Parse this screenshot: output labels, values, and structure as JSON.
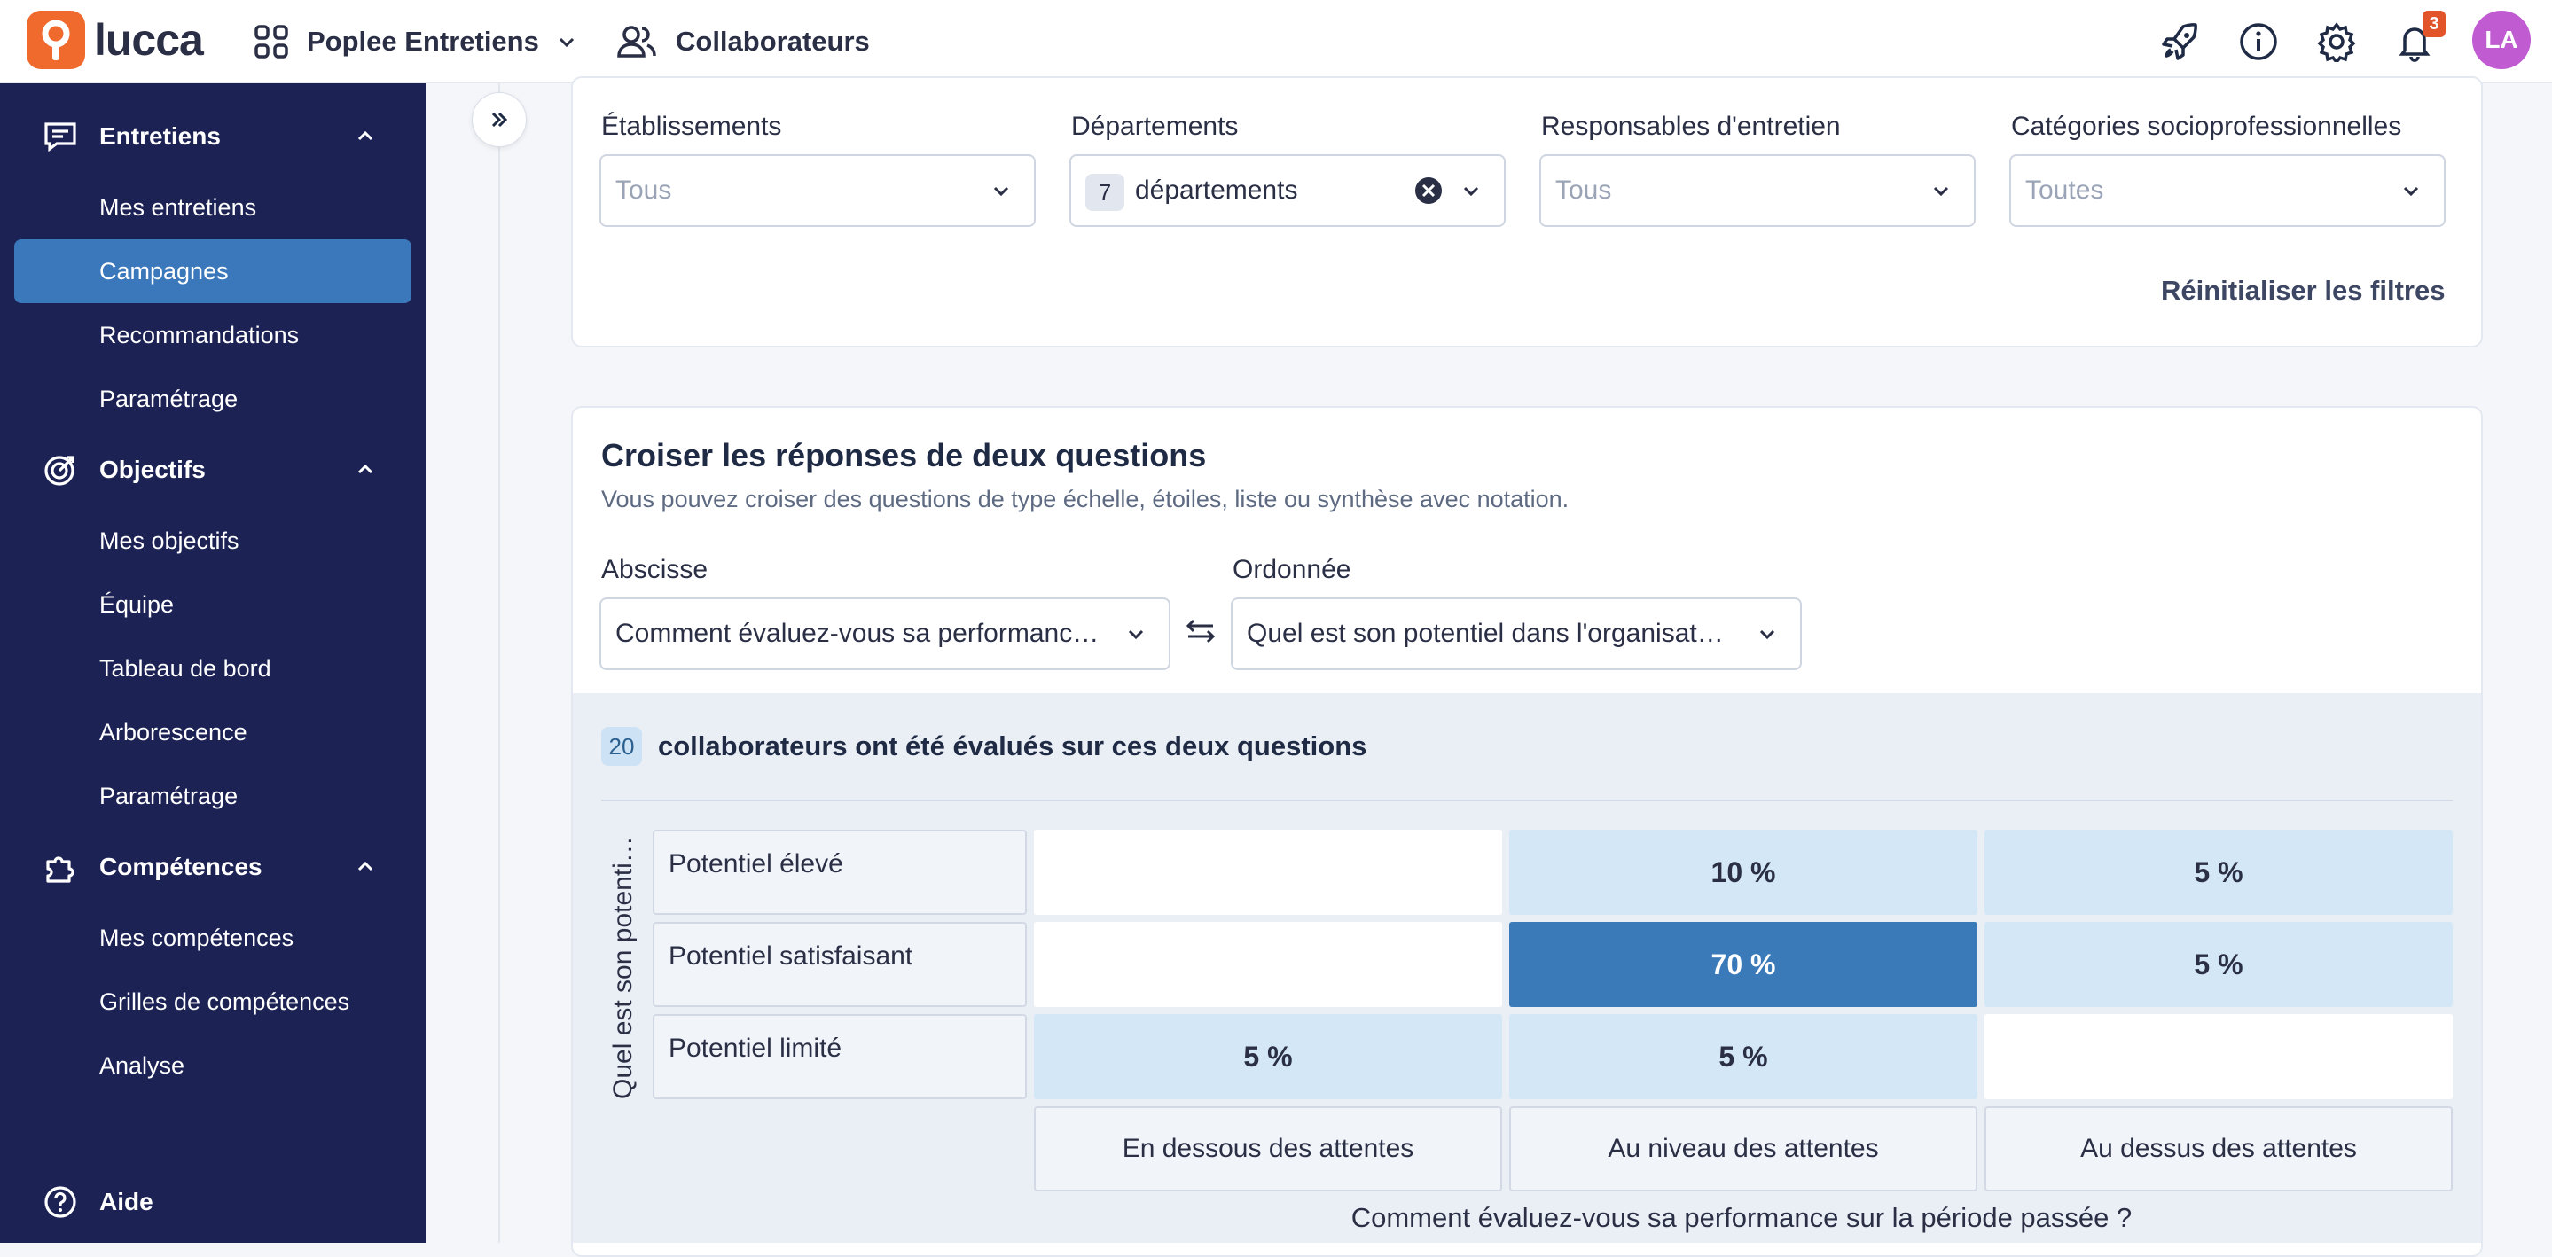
{
  "app": {
    "brand": "lucca",
    "module": "Poplee Entretiens",
    "collaborateurs": "Collaborateurs",
    "notifications": "3",
    "avatar": "LA"
  },
  "sidebar": {
    "entretiens": {
      "label": "Entretiens",
      "items": [
        "Mes entretiens",
        "Campagnes",
        "Recommandations",
        "Paramétrage"
      ]
    },
    "objectifs": {
      "label": "Objectifs",
      "items": [
        "Mes objectifs",
        "Équipe",
        "Tableau de bord",
        "Arborescence",
        "Paramétrage"
      ]
    },
    "competences": {
      "label": "Compétences",
      "items": [
        "Mes compétences",
        "Grilles de compétences",
        "Analyse"
      ]
    },
    "aide": "Aide"
  },
  "filters": {
    "etablissements": {
      "label": "Établissements",
      "value": "Tous"
    },
    "departements": {
      "label": "Départements",
      "count": "7",
      "value": "départements"
    },
    "responsables": {
      "label": "Responsables d'entretien",
      "value": "Tous"
    },
    "categories": {
      "label": "Catégories socioprofessionnelles",
      "value": "Toutes"
    },
    "reset": "Réinitialiser les filtres"
  },
  "cross": {
    "title": "Croiser les réponses de deux questions",
    "subtitle": "Vous pouvez croiser des questions de type échelle, étoiles, liste ou synthèse avec notation.",
    "abscisse_label": "Abscisse",
    "abscisse_value": "Comment évaluez-vous sa performanc…",
    "ordonnee_label": "Ordonnée",
    "ordonnee_value": "Quel est son potentiel dans l'organisat…",
    "count": "20",
    "count_text": "collaborateurs ont été évalués sur ces deux questions",
    "y_axis_title": "Quel est son potenti…",
    "x_axis_title": "Comment évaluez-vous sa performance sur la période passée ?",
    "rows": [
      "Potentiel élevé",
      "Potentiel satisfaisant",
      "Potentiel limité"
    ],
    "cols": [
      "En dessous des attentes",
      "Au niveau des attentes",
      "Au dessus des attentes"
    ],
    "cells": [
      [
        "",
        "10 %",
        "5 %"
      ],
      [
        "",
        "70 %",
        "5 %"
      ],
      [
        "5 %",
        "5 %",
        ""
      ]
    ]
  }
}
